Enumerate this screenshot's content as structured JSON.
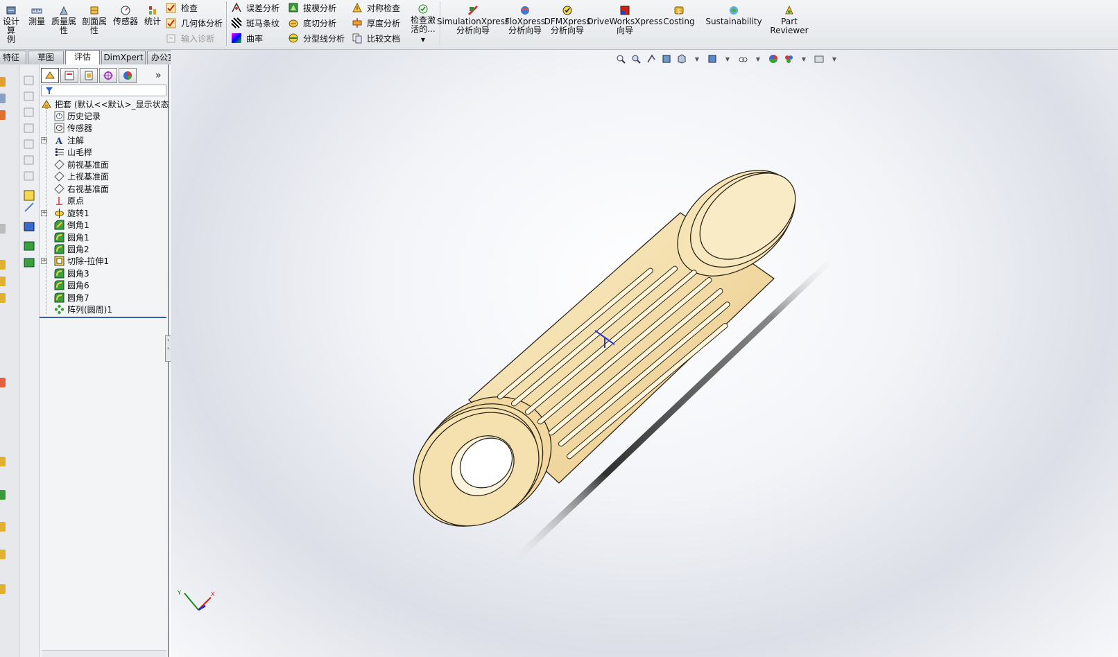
{
  "ribbon": {
    "design_study_label": "设计算\n例",
    "measure": "测量",
    "mass_props": "质量属\n性",
    "section_props": "剖面属\n性",
    "sensor": "传感器",
    "statistics": "统计",
    "check": "检查",
    "geometry_analysis": "几何体分析",
    "import_diagnostics": "输入诊断",
    "deviation_analysis": "误差分析",
    "zebra_stripes": "斑马条纹",
    "curvature": "曲率",
    "draft_analysis": "拔模分析",
    "undercut_analysis": "底切分析",
    "parting_line_analysis": "分型线分析",
    "symmetry_check": "对称检查",
    "thickness_analysis": "厚度分析",
    "compare_documents": "比较文档",
    "check_active": "检查激\n活的...",
    "simulationxpress": "SimulationXpress\n分析向导",
    "floxpress": "FloXpress\n分析向导",
    "dfmxpress": "DFMXpress\n分析向导",
    "driveworksxpress": "DriveWorksXpress\n向导",
    "costing": "Costing",
    "sustainability": "Sustainability",
    "part_reviewer": "Part\nReviewer"
  },
  "tabs": [
    {
      "label": "特征"
    },
    {
      "label": "草图"
    },
    {
      "label": "评估",
      "active": true
    },
    {
      "label": "DimXpert"
    },
    {
      "label": "办公室产品"
    }
  ],
  "feature_tree": {
    "root": "把套 (默认<<默认>_显示状态",
    "items": [
      {
        "label": "历史记录",
        "icon": "history-icon",
        "expandable": false
      },
      {
        "label": "传感器",
        "icon": "sensor-icon",
        "expandable": false
      },
      {
        "label": "注解",
        "icon": "annotation-icon",
        "expandable": true
      },
      {
        "label": "山毛榉",
        "icon": "material-icon",
        "expandable": false
      },
      {
        "label": "前视基准面",
        "icon": "plane-icon",
        "expandable": false
      },
      {
        "label": "上视基准面",
        "icon": "plane-icon",
        "expandable": false
      },
      {
        "label": "右视基准面",
        "icon": "plane-icon",
        "expandable": false
      },
      {
        "label": "原点",
        "icon": "origin-icon",
        "expandable": false
      },
      {
        "label": "旋转1",
        "icon": "revolve-icon",
        "expandable": true
      },
      {
        "label": "倒角1",
        "icon": "chamfer-icon",
        "expandable": false
      },
      {
        "label": "圆角1",
        "icon": "fillet-icon",
        "expandable": false
      },
      {
        "label": "圆角2",
        "icon": "fillet-icon",
        "expandable": false
      },
      {
        "label": "切除-拉伸1",
        "icon": "cut-extrude-icon",
        "expandable": true
      },
      {
        "label": "圆角3",
        "icon": "fillet-icon",
        "expandable": false
      },
      {
        "label": "圆角6",
        "icon": "fillet-icon",
        "expandable": false
      },
      {
        "label": "圆角7",
        "icon": "fillet-icon",
        "expandable": false
      },
      {
        "label": "阵列(圆周)1",
        "icon": "circular-pattern-icon",
        "expandable": false
      }
    ]
  },
  "triad": {
    "y_label": "Y",
    "x_label": "X"
  },
  "colors": {
    "model_fill": "#f3dca8",
    "model_edge": "#2a2416",
    "accent": "#3560a8"
  }
}
